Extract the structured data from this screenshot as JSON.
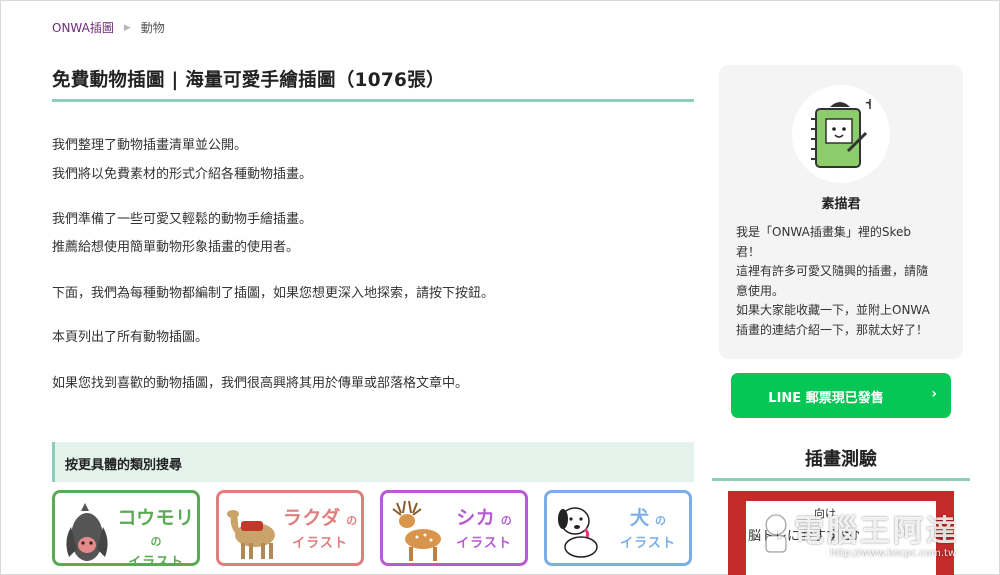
{
  "breadcrumb": {
    "home": "ONWA插圖",
    "separator": "▶",
    "current": "動物"
  },
  "page": {
    "title": "免費動物插圖 | 海量可愛手繪插圖（1076張）"
  },
  "intro": [
    "我們整理了動物插畫清單並公開。",
    "我們將以免費素材的形式介紹各種動物插畫。",
    "我們準備了一些可愛又輕鬆的動物手繪插畫。",
    "推薦給想使用簡單動物形象插畫的使用者。",
    "下面，我們為每種動物都編制了插圖，如果您想更深入地探索，請按下按鈕。",
    "本頁列出了所有動物插圖。",
    "如果您找到喜歡的動物插圖，我們很高興將其用於傳單或部落格文章中。"
  ],
  "category": {
    "header": "按更具體的類別搜尋",
    "cards": [
      {
        "name": "コウモリ",
        "no": "の",
        "sub": "イラスト",
        "color": "#5aaa54",
        "icon": "bat-icon"
      },
      {
        "name": "ラクダ",
        "no": "の",
        "sub": "イラスト",
        "color": "#e07d7d",
        "icon": "camel-icon"
      },
      {
        "name": "シカ",
        "no": "の",
        "sub": "イラスト",
        "color": "#b85ad0",
        "icon": "deer-icon"
      },
      {
        "name": "犬",
        "no": "の",
        "sub": "イラスト",
        "color": "#7aaee8",
        "icon": "dog-icon"
      }
    ]
  },
  "sidebar": {
    "profile": {
      "name": "素描君",
      "bio": [
        "我是「ONWA插畫集」裡的Skeb",
        "君！",
        "這裡有許多可愛又隨興的插畫，請隨",
        "意使用。",
        "如果大家能收藏一下，並附上ONWA",
        "插畫的連結介紹一下，那就太好了！"
      ]
    },
    "line_button": {
      "label": "LINE 郵票現已發售",
      "chevron": "›"
    },
    "quiz": {
      "title": "插畫測驗",
      "banner_line1": "向け",
      "banner_line2": "脳トレにおすすめ♪"
    }
  },
  "watermark": {
    "text": "電腦王阿達",
    "url": "http://www.kocpc.com.tw"
  },
  "colors": {
    "accent_rule": "#8ccfb7",
    "line_green": "#06c755",
    "breadcrumb_home": "#6d2a7a"
  }
}
